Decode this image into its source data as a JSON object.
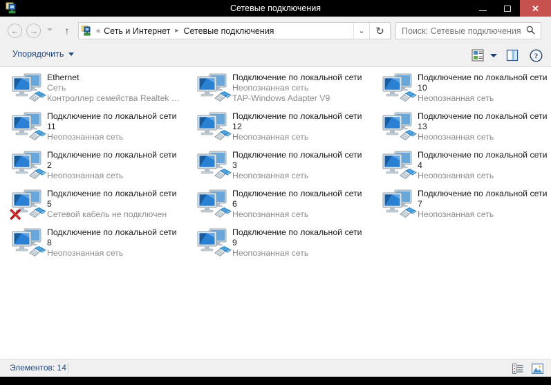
{
  "window": {
    "title": "Сетевые подключения",
    "app_icon": "network-connections-icon",
    "minimize_label": "Свернуть",
    "maximize_label": "Развернуть",
    "close_label": "Закрыть",
    "close_button_color": "#c75050",
    "titlebar_color": "#000000"
  },
  "navbar": {
    "back_glyph": "←",
    "forward_glyph": "→",
    "recent_glyph": "▾",
    "up_glyph": "↑",
    "address": {
      "icon": "network-icon",
      "overflow_glyph": "«",
      "crumbs": [
        "Сеть и Интернет",
        "Сетевые подключения"
      ],
      "separator_glyph": "▸",
      "dropdown_glyph": "⌄",
      "refresh_glyph": "↻"
    },
    "search": {
      "placeholder": "Поиск: Сетевые подключения",
      "icon": "search-icon"
    }
  },
  "command_bar": {
    "organize_label": "Упорядочить",
    "organize_caret": "▾",
    "view_options_icon": "view-options-icon",
    "preview_pane_icon": "preview-pane-icon",
    "help_icon": "help-icon"
  },
  "connections": [
    {
      "name": "Ethernet",
      "network": "Сеть",
      "adapter": "Контроллер семейства Realtek P...",
      "icon": "network-adapter-icon",
      "disconnected": false
    },
    {
      "name": "Подключение по локальной сети",
      "network": "Неопознанная сеть",
      "adapter": "TAP-Windows Adapter V9",
      "icon": "network-adapter-icon",
      "disconnected": false
    },
    {
      "name": "Подключение по локальной сети 10",
      "network": "Неопознанная сеть",
      "adapter": "",
      "icon": "network-adapter-icon",
      "disconnected": false
    },
    {
      "name": "Подключение по локальной сети 11",
      "network": "Неопознанная сеть",
      "adapter": "",
      "icon": "network-adapter-icon",
      "disconnected": false
    },
    {
      "name": "Подключение по локальной сети 12",
      "network": "Неопознанная сеть",
      "adapter": "",
      "icon": "network-adapter-icon",
      "disconnected": false
    },
    {
      "name": "Подключение по локальной сети 13",
      "network": "Неопознанная сеть",
      "adapter": "",
      "icon": "network-adapter-icon",
      "disconnected": false
    },
    {
      "name": "Подключение по локальной сети 2",
      "network": "Неопознанная сеть",
      "adapter": "",
      "icon": "network-adapter-icon",
      "disconnected": false
    },
    {
      "name": "Подключение по локальной сети 3",
      "network": "Неопознанная сеть",
      "adapter": "",
      "icon": "network-adapter-icon",
      "disconnected": false
    },
    {
      "name": "Подключение по локальной сети 4",
      "network": "Неопознанная сеть",
      "adapter": "",
      "icon": "network-adapter-icon",
      "disconnected": false
    },
    {
      "name": "Подключение по локальной сети 5",
      "network": "Сетевой кабель не подключен",
      "adapter": "",
      "icon": "network-adapter-disconnected-icon",
      "disconnected": true
    },
    {
      "name": "Подключение по локальной сети 6",
      "network": "Неопознанная сеть",
      "adapter": "",
      "icon": "network-adapter-icon",
      "disconnected": false
    },
    {
      "name": "Подключение по локальной сети 7",
      "network": "Неопознанная сеть",
      "adapter": "",
      "icon": "network-adapter-icon",
      "disconnected": false
    },
    {
      "name": "Подключение по локальной сети 8",
      "network": "Неопознанная сеть",
      "adapter": "",
      "icon": "network-adapter-icon",
      "disconnected": false
    },
    {
      "name": "Подключение по локальной сети 9",
      "network": "Неопознанная сеть",
      "adapter": "",
      "icon": "network-adapter-icon",
      "disconnected": false
    }
  ],
  "status_bar": {
    "item_count_label": "Элементов: 14",
    "details_view_icon": "details-view-icon",
    "large-icons_view_icon": "large-icons-view-icon"
  }
}
